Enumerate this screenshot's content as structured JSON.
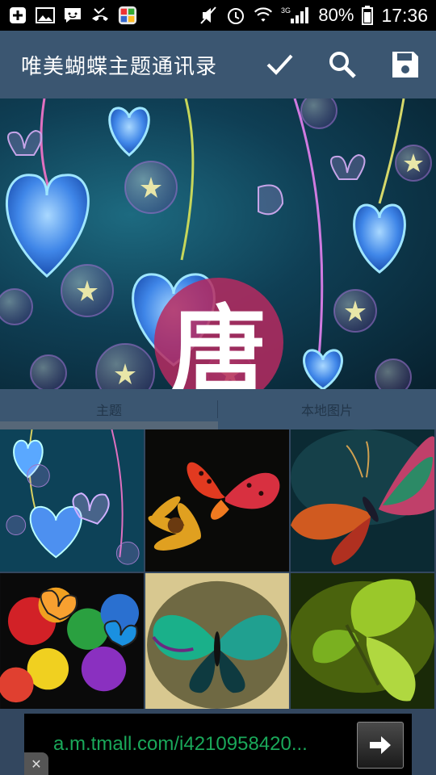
{
  "status_bar": {
    "battery": "80%",
    "time": "17:36",
    "network": "3G",
    "icons": [
      "add-icon",
      "image-icon",
      "message-icon",
      "missed-call-icon",
      "app-icon",
      "mute-icon",
      "alarm-icon",
      "wifi-icon",
      "signal-icon",
      "battery-icon"
    ]
  },
  "header": {
    "title": "唯美蝴蝶主题通讯录",
    "actions": [
      "check-icon",
      "search-icon",
      "save-icon"
    ]
  },
  "banner": {
    "avatar_char": "唐"
  },
  "tabs": [
    {
      "label": "主题",
      "active": true
    },
    {
      "label": "本地图片",
      "active": false
    }
  ],
  "grid": {
    "items": [
      "heart-butterfly-thumb",
      "red-butterfly-thumb",
      "feather-butterfly-thumb",
      "rainbow-butterfly-thumb",
      "teal-butterfly-thumb",
      "green-butterfly-thumb"
    ]
  },
  "ad": {
    "text": "a.m.tmall.com/i4210958420...",
    "close": "✕"
  },
  "colors": {
    "actionbar": "#3b5671",
    "background": "#33475f",
    "avatar": "#b62a60",
    "ad_text": "#1aa85a"
  }
}
